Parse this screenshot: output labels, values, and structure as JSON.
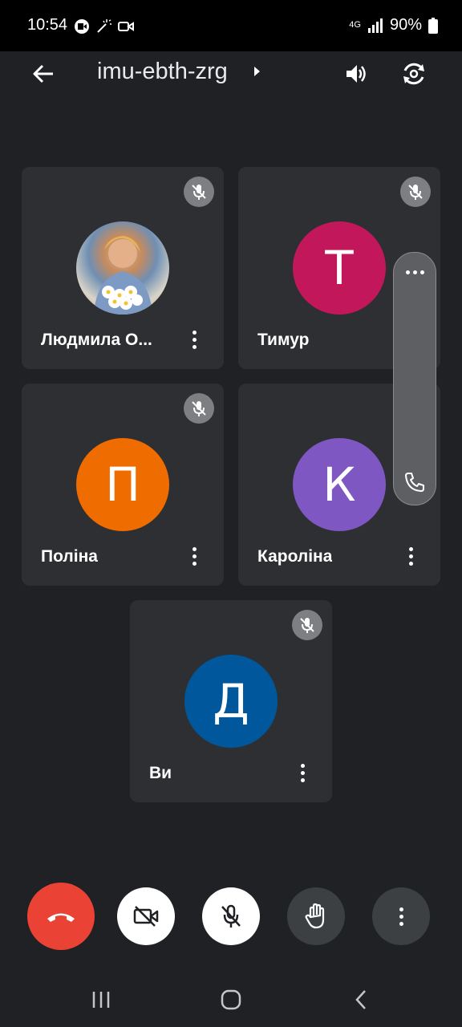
{
  "status": {
    "time": "10:54",
    "network": "4G",
    "battery": "90%"
  },
  "header": {
    "meeting_code": "imu-ebth-zrg",
    "icons": [
      "back-arrow-icon",
      "chevron-right-icon",
      "speaker-icon",
      "camera-flip-icon"
    ]
  },
  "participants": [
    {
      "name": "Людмила О...",
      "initial": "",
      "avatar_color": "#b58a63",
      "muted": true
    },
    {
      "name": "Тимур",
      "initial": "Т",
      "avatar_color": "#c2185b",
      "muted": true
    },
    {
      "name": "Поліна",
      "initial": "П",
      "avatar_color": "#ef6c00",
      "muted": true
    },
    {
      "name": "Кароліна",
      "initial": "К",
      "avatar_color": "#7e57c2",
      "muted": false
    },
    {
      "name": "Ви",
      "initial": "Д",
      "avatar_color": "#01579b",
      "muted": true
    }
  ],
  "side_panel": {
    "icons": [
      "more-horizontal-icon",
      "phone-icon"
    ]
  },
  "controls": {
    "end_call_color": "#ea4335",
    "icons": [
      "end-call-icon",
      "camera-off-icon",
      "mic-off-icon",
      "raise-hand-icon",
      "more-vertical-icon"
    ]
  }
}
